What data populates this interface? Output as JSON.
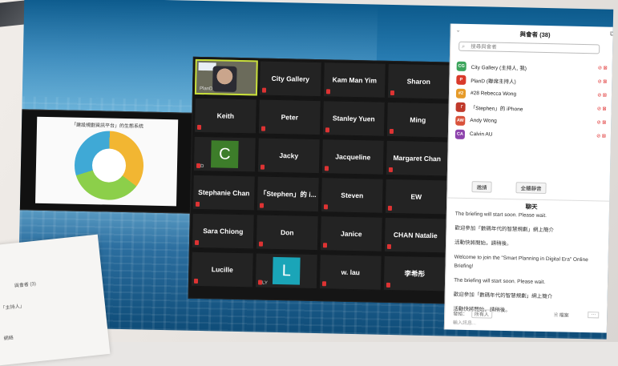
{
  "participants_panel": {
    "title": "與會者 (38)",
    "search_placeholder": "搜尋與會者",
    "participants": [
      {
        "initials": "CG",
        "name": "City Gallery (主持人, 我)",
        "color": "#3ca55c"
      },
      {
        "initials": "P",
        "name": "PlanD (聯席主持人)",
        "color": "#d93a2b"
      },
      {
        "initials": "#2",
        "name": "#28 Rebecca Wong",
        "color": "#e69b2a"
      },
      {
        "initials": "「",
        "name": "「Stephen」的 iPhone",
        "color": "#c0392b"
      },
      {
        "initials": "AW",
        "name": "Andy Wong",
        "color": "#d9523b"
      },
      {
        "initials": "CA",
        "name": "Calvin AU",
        "color": "#8e44ad"
      }
    ],
    "invite_label": "邀請",
    "mute_all_label": "全體靜音"
  },
  "chat": {
    "title": "聊天",
    "messages": [
      "The briefing will start soon. Please wait.",
      "歡迎參加「數碼年代的智慧規劃」網上簡介",
      "活動快將開始，請稍後。",
      "Welcome to join the \"Smart Planning in Digital Era\" Online Briefing!",
      "The briefing will start soon. Please wait.",
      "歡迎參加「數碼年代的智慧規劃」網上簡介",
      "活動快將開始，請稍後。"
    ],
    "send_to_label": "發給：",
    "send_to_value": "所有人",
    "file_label": "檔案",
    "input_placeholder": "輸入訊息..."
  },
  "gallery": {
    "host_label": "PlanD",
    "tiles": [
      "City Gallery",
      "Kam Man Yim",
      "Sharon",
      "Keith",
      "Peter",
      "Stanley Yuen",
      "Ming",
      "C",
      "Jacky",
      "Jacqueline",
      "Margaret Chan",
      "Stephanie Chan",
      "「Stephen」的 i...",
      "Steven",
      "EW",
      "Sara Chiong",
      "Don",
      "Janice",
      "CHAN Natalie",
      "Lucille",
      "L",
      "w. lau",
      "李希彤"
    ],
    "tile_sub_c": "D",
    "tile_sub_l": "LY"
  },
  "slide": {
    "title": "「建設規劃資訊平台」的生態系統"
  },
  "paper_panel": {
    "title": "與會者 (3)",
    "line1": "「主持人」",
    "line2": "網絡"
  }
}
